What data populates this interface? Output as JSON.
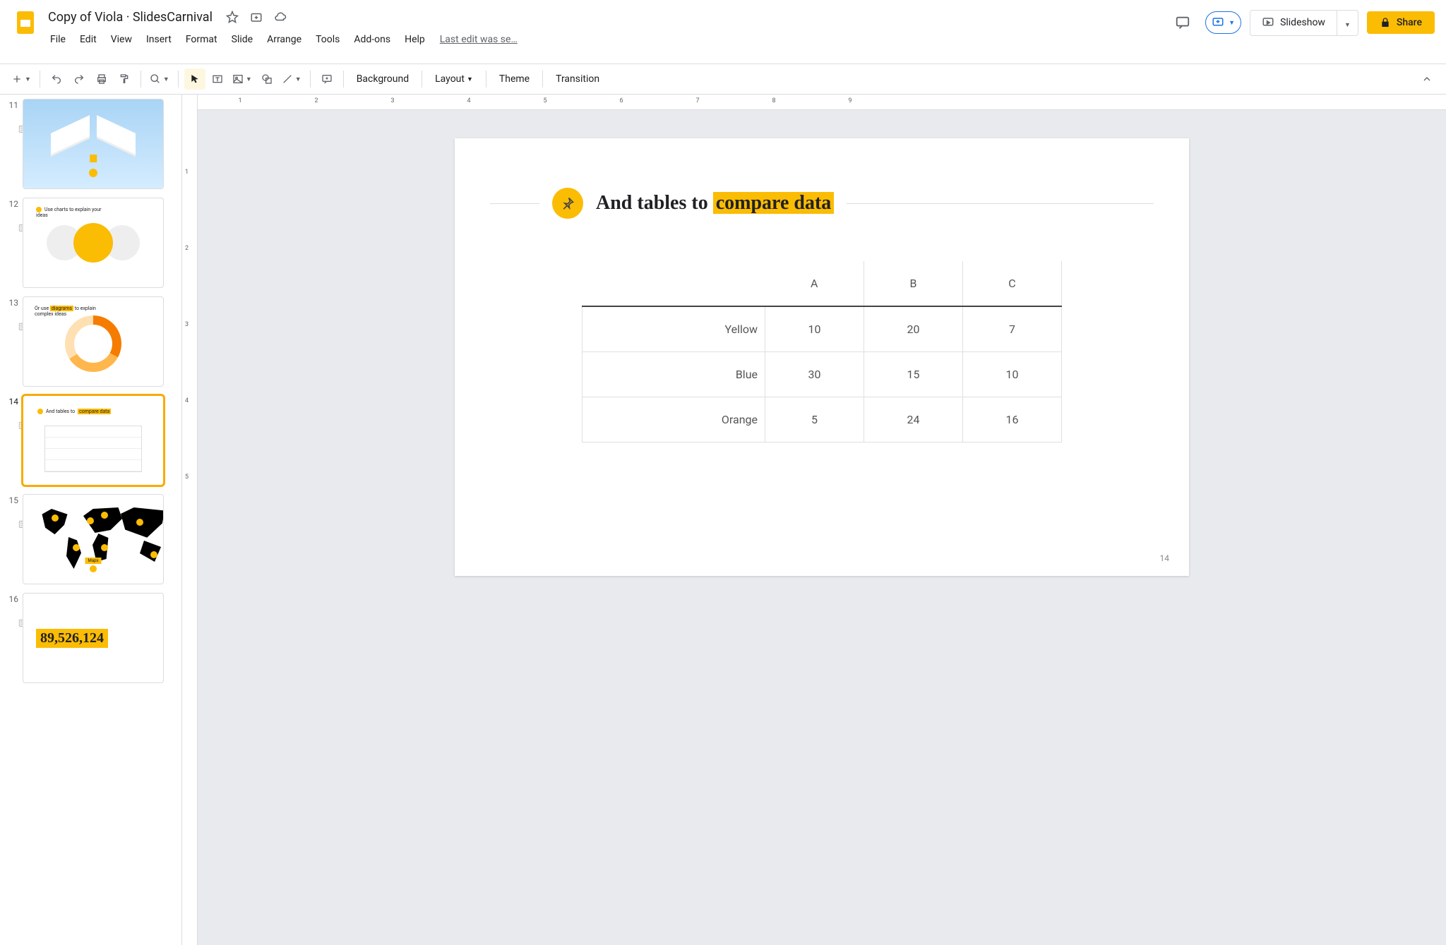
{
  "doc_title": "Copy of Viola · SlidesCarnival",
  "last_edit": "Last edit was se…",
  "menus": [
    "File",
    "Edit",
    "View",
    "Insert",
    "Format",
    "Slide",
    "Arrange",
    "Tools",
    "Add-ons",
    "Help"
  ],
  "header_buttons": {
    "slideshow": "Slideshow",
    "share": "Share"
  },
  "toolbar": {
    "background": "Background",
    "layout": "Layout",
    "theme": "Theme",
    "transition": "Transition"
  },
  "filmstrip": {
    "slides": [
      {
        "num": "11"
      },
      {
        "num": "12"
      },
      {
        "num": "13"
      },
      {
        "num": "14",
        "selected": true
      },
      {
        "num": "15"
      },
      {
        "num": "16"
      }
    ],
    "slide16_bignum": "89,526,124"
  },
  "current_slide": {
    "title_prefix": "And tables to ",
    "title_highlight": "compare data",
    "page_number": "14"
  },
  "chart_data": {
    "type": "table",
    "title": "And tables to compare data",
    "columns": [
      "A",
      "B",
      "C"
    ],
    "rows": [
      {
        "label": "Yellow",
        "values": [
          10,
          20,
          7
        ]
      },
      {
        "label": "Blue",
        "values": [
          30,
          15,
          10
        ]
      },
      {
        "label": "Orange",
        "values": [
          5,
          24,
          16
        ]
      }
    ]
  },
  "ruler": {
    "h": [
      1,
      2,
      3,
      4,
      5,
      6,
      7,
      8,
      9
    ],
    "v": [
      1,
      2,
      3,
      4,
      5
    ]
  }
}
